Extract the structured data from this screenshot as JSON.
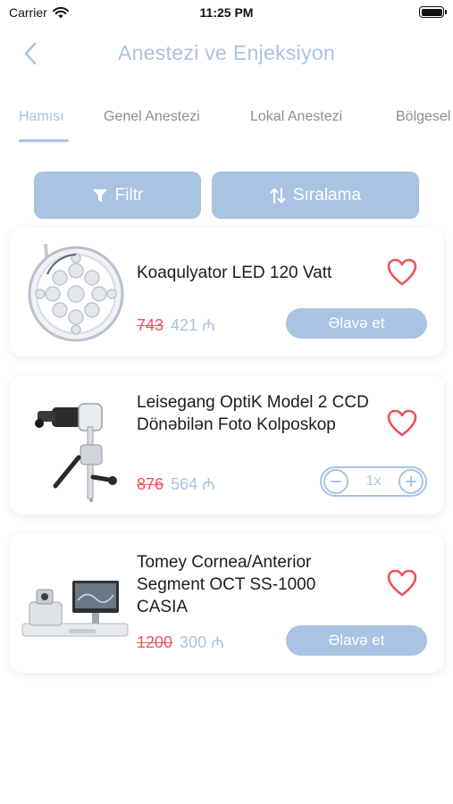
{
  "status_bar": {
    "carrier": "Carrier",
    "time": "11:25 PM"
  },
  "header": {
    "title": "Anestezi ve Enjeksiyon",
    "back_icon": "chevron-left-icon"
  },
  "tabs": [
    {
      "label": "Hamısı",
      "active": true
    },
    {
      "label": "Genel Anestezi",
      "active": false
    },
    {
      "label": "Lokal Anestezi",
      "active": false
    },
    {
      "label": "Bölgesel",
      "active": false
    }
  ],
  "actions": {
    "filter_label": "Filtr",
    "sort_label": "Sıralama"
  },
  "products": [
    {
      "name": "Koaqulyator LED 120 Vatt",
      "old_price": "743",
      "new_price": "421 ₼",
      "add_label": "Əlavə et"
    },
    {
      "name": "Leisegang OptiK Model 2 CCD Dönəbilən Foto Kolposkop",
      "old_price": "876",
      "new_price": "564 ₼",
      "quantity": "1x"
    },
    {
      "name": "Tomey Cornea/Anterior Segment OCT SS-1000 CASIA",
      "old_price": "1200",
      "new_price": "300 ₼",
      "add_label": "Əlavə et"
    }
  ],
  "colors": {
    "accent": "#a9c3e3",
    "old_price": "#e8565b",
    "heart": "#e8565b"
  }
}
